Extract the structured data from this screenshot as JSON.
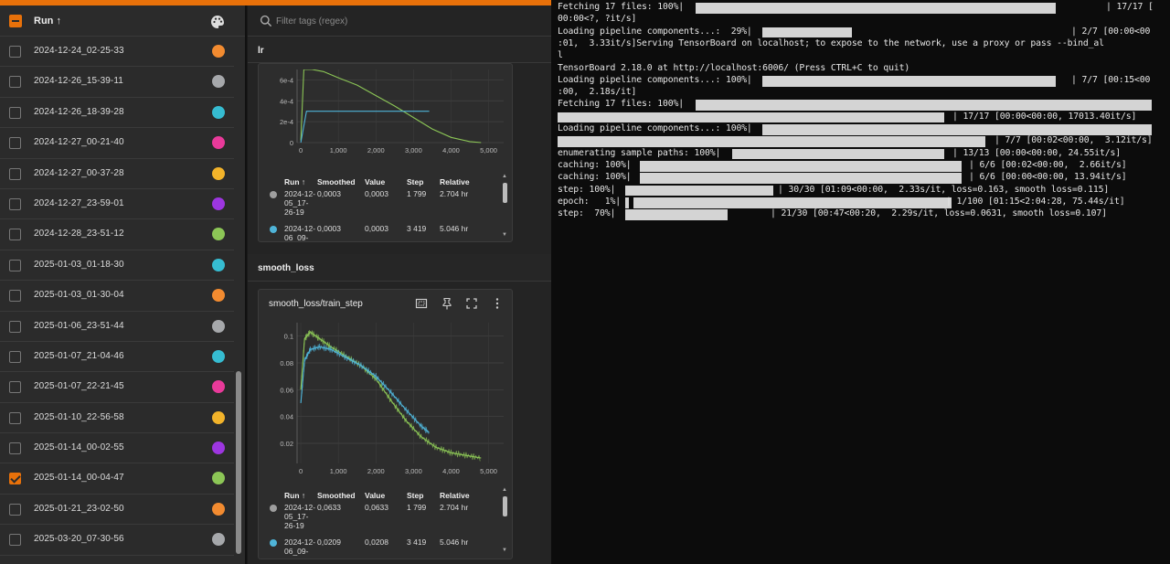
{
  "runs": {
    "header_label": "Run ↑",
    "items": [
      {
        "name": "2024-12-24_02-25-33",
        "color": "#f28b30",
        "checked": false
      },
      {
        "name": "2024-12-26_15-39-11",
        "color": "#a6a8ab",
        "checked": false
      },
      {
        "name": "2024-12-26_18-39-28",
        "color": "#36bcd1",
        "checked": false
      },
      {
        "name": "2024-12-27_00-21-40",
        "color": "#e93a9a",
        "checked": false
      },
      {
        "name": "2024-12-27_00-37-28",
        "color": "#f2b32a",
        "checked": false
      },
      {
        "name": "2024-12-27_23-59-01",
        "color": "#9d36e0",
        "checked": false
      },
      {
        "name": "2024-12-28_23-51-12",
        "color": "#8cc656",
        "checked": false
      },
      {
        "name": "2025-01-03_01-18-30",
        "color": "#36bcd1",
        "checked": false
      },
      {
        "name": "2025-01-03_01-30-04",
        "color": "#f28b30",
        "checked": false
      },
      {
        "name": "2025-01-06_23-51-44",
        "color": "#a6a8ab",
        "checked": false
      },
      {
        "name": "2025-01-07_21-04-46",
        "color": "#36bcd1",
        "checked": false
      },
      {
        "name": "2025-01-07_22-21-45",
        "color": "#e93a9a",
        "checked": false
      },
      {
        "name": "2025-01-10_22-56-58",
        "color": "#f2b32a",
        "checked": false
      },
      {
        "name": "2025-01-14_00-02-55",
        "color": "#9d36e0",
        "checked": false
      },
      {
        "name": "2025-01-14_00-04-47",
        "color": "#8cc656",
        "checked": true
      },
      {
        "name": "2025-01-21_23-02-50",
        "color": "#f28b30",
        "checked": false
      },
      {
        "name": "2025-03-20_07-30-56",
        "color": "#a6a8ab",
        "checked": false
      }
    ]
  },
  "filter": {
    "placeholder": "Filter tags (regex)"
  },
  "sections": {
    "lr": "lr",
    "smooth_loss": "smooth_loss"
  },
  "lr_card": {
    "y_ticks": [
      "6e-4",
      "4e-4",
      "2e-4",
      "0"
    ],
    "x_ticks": [
      "0",
      "1,000",
      "2,000",
      "3,000",
      "4,000",
      "5,000"
    ],
    "table": {
      "headers": [
        "Run ↑",
        "Smoothed",
        "Value",
        "Step",
        "Relative"
      ],
      "rows": [
        {
          "run": "2024-12-05_17-26-19",
          "run_lines": [
            "2024-12-",
            "05_17-",
            "26-19"
          ],
          "smoothed": "0,0003",
          "value": "0,0003",
          "step": "1 799",
          "relative": "2.704 hr",
          "color": "#9e9e9e"
        },
        {
          "run": "2024-12-",
          "run_lines": [
            "2024-12-",
            "06_09-"
          ],
          "smoothed": "0,0003",
          "value": "0,0003",
          "step": "3 419",
          "relative": "5.046 hr",
          "color": "#4fb4d8"
        }
      ]
    }
  },
  "smooth_card": {
    "title": "smooth_loss/train_step",
    "y_ticks": [
      "0.1",
      "0.08",
      "0.06",
      "0.04",
      "0.02"
    ],
    "x_ticks": [
      "0",
      "1,000",
      "2,000",
      "3,000",
      "4,000",
      "5,000"
    ],
    "table": {
      "headers": [
        "Run ↑",
        "Smoothed",
        "Value",
        "Step",
        "Relative"
      ],
      "rows": [
        {
          "run": "2024-12-05_17-26-19",
          "run_lines": [
            "2024-12-",
            "05_17-",
            "26-19"
          ],
          "smoothed": "0,0633",
          "value": "0,0633",
          "step": "1 799",
          "relative": "2.704 hr",
          "color": "#9e9e9e"
        },
        {
          "run": "2024-12-",
          "run_lines": [
            "2024-12-",
            "06_09-"
          ],
          "smoothed": "0,0209",
          "value": "0,0208",
          "step": "3 419",
          "relative": "5.046 hr",
          "color": "#4fb4d8"
        }
      ]
    }
  },
  "chart_data": [
    {
      "type": "line",
      "title": "lr",
      "ylim": [
        0,
        0.0007
      ],
      "xlim": [
        -100,
        5400
      ],
      "series": [
        {
          "color": "#8cc656",
          "x": [
            0,
            80,
            300,
            600,
            1000,
            1500,
            2000,
            2500,
            3000,
            3500,
            4000,
            4500,
            4800
          ],
          "y": [
            2e-05,
            0.0007,
            0.0007,
            0.00068,
            0.00062,
            0.00055,
            0.00045,
            0.00035,
            0.00024,
            0.00013,
            5e-05,
            1e-05,
            0
          ]
        },
        {
          "color": "#4fb4d8",
          "x": [
            0,
            150,
            300,
            1000,
            2000,
            3000,
            3419
          ],
          "y": [
            0,
            0.0003,
            0.0003,
            0.0003,
            0.0003,
            0.0003,
            0.0003
          ]
        }
      ]
    },
    {
      "type": "line",
      "title": "smooth_loss/train_step",
      "ylim": [
        0.005,
        0.11
      ],
      "xlim": [
        -100,
        5400
      ],
      "series": [
        {
          "color": "#8cc656",
          "x": [
            0,
            100,
            250,
            500,
            800,
            1200,
            1600,
            2000,
            2400,
            2800,
            3200,
            3600,
            4000,
            4400,
            4800
          ],
          "y": [
            0.06,
            0.098,
            0.103,
            0.098,
            0.092,
            0.085,
            0.078,
            0.068,
            0.052,
            0.037,
            0.025,
            0.017,
            0.013,
            0.011,
            0.009
          ]
        },
        {
          "color": "#4fb4d8",
          "x": [
            0,
            100,
            250,
            500,
            800,
            1200,
            1600,
            2000,
            2400,
            2800,
            3200,
            3419
          ],
          "y": [
            0.05,
            0.082,
            0.09,
            0.092,
            0.09,
            0.084,
            0.078,
            0.07,
            0.058,
            0.045,
            0.033,
            0.028
          ]
        }
      ]
    }
  ],
  "terminal": {
    "lines": [
      {
        "text": "Fetching 17 files: 100%|",
        "bar": [
          0.228,
          0.822
        ],
        "tail": "| 17/17 [",
        "tail_x": 600
      },
      {
        "text": "00:00<?, ?it/s]"
      },
      {
        "text": "Loading pipeline components...:  29%|",
        "bar": [
          0.338,
          0.485
        ],
        "tail": "| 2/7 [00:00<00",
        "tail_x": 562
      },
      {
        "text": ":01,  3.33it/s]Serving TensorBoard on localhost; to expose to the network, use a proxy or pass --bind_al"
      },
      {
        "text": "l"
      },
      {
        "text": "TensorBoard 2.18.0 at http://localhost:6006/ (Press CTRL+C to quit)"
      },
      {
        "text": "Loading pipeline components...: 100%|",
        "bar": [
          0.338,
          0.822
        ],
        "tail": "| 7/7 [00:15<00",
        "tail_x": 562
      },
      {
        "text": ":00,  2.18s/it]"
      },
      {
        "text": "Fetching 17 files: 100%|",
        "bar": [
          0.228,
          0.98
        ]
      },
      {
        "text": "",
        "bar": [
          0.0,
          0.638
        ],
        "tail": "| 17/17 [00:00<00:00, 17013.40it/s]",
        "tail_x": 432
      },
      {
        "text": "Loading pipeline components...: 100%|",
        "bar": [
          0.338,
          0.98
        ]
      },
      {
        "text": "",
        "bar": [
          0.0,
          0.706
        ],
        "tail": "| 7/7 [00:02<00:00,  3.12it/s]",
        "tail_x": 478
      },
      {
        "text": "enumerating sample paths: 100%|",
        "bar": [
          0.288,
          0.638
        ],
        "tail": "| 13/13 [00:00<00:00, 24.55it/s]",
        "tail_x": 432
      },
      {
        "text": "caching: 100%|",
        "bar": [
          0.135,
          0.666
        ],
        "tail": "| 6/6 [00:02<00:00,  2.66it/s]",
        "tail_x": 450
      },
      {
        "text": "caching: 100%|",
        "bar": [
          0.135,
          0.666
        ],
        "tail": "| 6/6 [00:00<00:00, 13.94it/s]",
        "tail_x": 450
      },
      {
        "text": "step: 100%|",
        "bar": [
          0.112,
          0.356
        ],
        "tail": "| 30/30 [01:09<00:00,  2.33s/it, loss=0.163, smooth loss=0.115]",
        "tail_x": 241
      },
      {
        "text": "epoch:   1%|",
        "bar": [
          0.112,
          0.118
        ],
        "bar2": [
          0.125,
          0.65
        ],
        "tail": "| 1/100 [01:15<2:04:28, 75.44s/it]",
        "tail_x": 425
      },
      {
        "text": "step:  70%|",
        "bar": [
          0.112,
          0.28
        ],
        "tail": "| 21/30 [00:47<00:20,  2.29s/it, loss=0.0631, smooth loss=0.107]",
        "tail_x": 233
      }
    ]
  }
}
